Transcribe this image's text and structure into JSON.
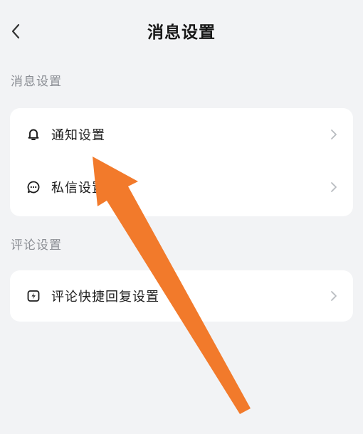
{
  "header": {
    "title": "消息设置",
    "back_icon": "chevron-left-icon"
  },
  "sections": [
    {
      "label": "消息设置",
      "items": [
        {
          "label": "通知设置",
          "icon": "bell-icon"
        },
        {
          "label": "私信设置",
          "icon": "message-bubble-icon"
        }
      ]
    },
    {
      "label": "评论设置",
      "items": [
        {
          "label": "评论快捷回复设置",
          "icon": "lightning-icon"
        }
      ]
    }
  ],
  "annotation": {
    "type": "arrow",
    "color": "#f27a2b",
    "points_to": "通知设置"
  },
  "colors": {
    "background": "#f2f3f5",
    "card": "#ffffff",
    "section_label": "#8a8d93",
    "chevron": "#b8bbc0"
  }
}
